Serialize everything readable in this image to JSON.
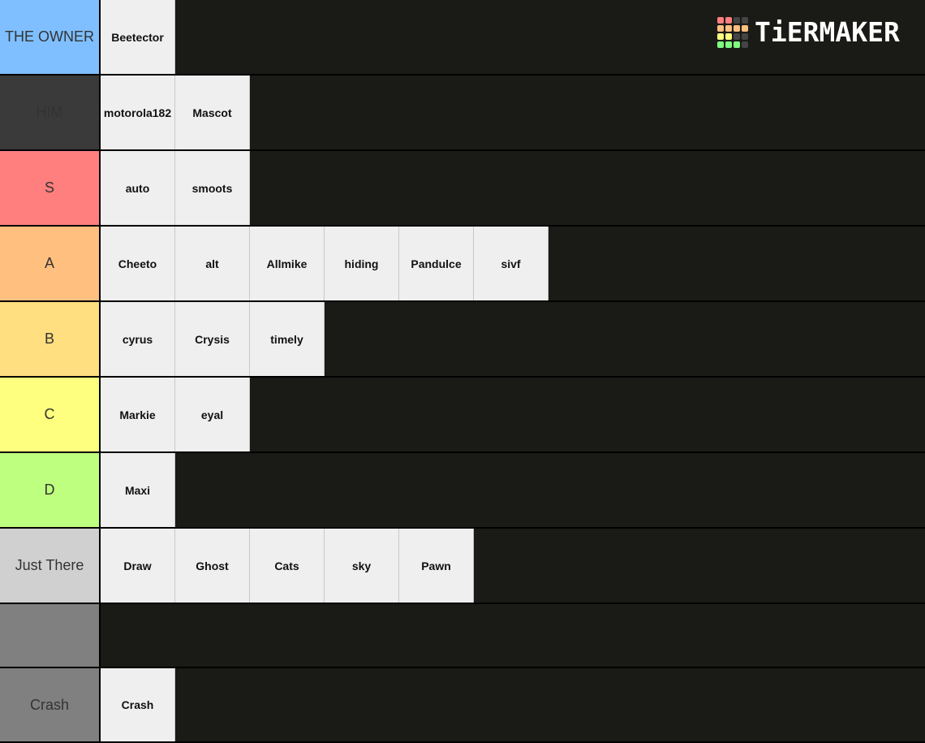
{
  "logo": {
    "text": "TiERMAKER",
    "grid_colors": [
      "#ff7f7f",
      "#ff7f7f",
      "#444444",
      "#444444",
      "#ffbf7f",
      "#ffbf7f",
      "#ffbf7f",
      "#ffbf7f",
      "#ffff7f",
      "#ffff7f",
      "#444444",
      "#444444",
      "#7fff7f",
      "#7fff7f",
      "#7fff7f",
      "#444444"
    ]
  },
  "tiers": [
    {
      "label": "THE OWNER",
      "color": "#7fbfff",
      "items": [
        "Beetector"
      ]
    },
    {
      "label": "HIM",
      "color": "#3a3a3a",
      "items": [
        "motorola182",
        "Mascot"
      ]
    },
    {
      "label": "S",
      "color": "#ff7f7f",
      "items": [
        "auto",
        "smoots"
      ]
    },
    {
      "label": "A",
      "color": "#ffbf7f",
      "items": [
        "Cheeto",
        "alt",
        "Allmike",
        "hiding",
        "Pandulce",
        "sivf"
      ]
    },
    {
      "label": "B",
      "color": "#ffdf7f",
      "items": [
        "cyrus",
        "Crysis",
        "timely"
      ]
    },
    {
      "label": "C",
      "color": "#ffff7f",
      "items": [
        "Markie",
        "eyal"
      ]
    },
    {
      "label": "D",
      "color": "#bfff7f",
      "items": [
        "Maxi"
      ]
    },
    {
      "label": "Just There",
      "color": "#d0d0d0",
      "items": [
        "Draw",
        "Ghost",
        "Cats",
        "sky",
        "Pawn"
      ]
    },
    {
      "label": "",
      "color": "#808080",
      "items": []
    },
    {
      "label": "Crash",
      "color": "#808080",
      "items": [
        "Crash"
      ]
    }
  ]
}
